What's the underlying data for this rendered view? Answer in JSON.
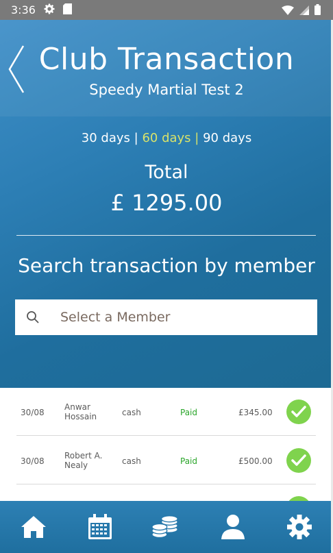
{
  "status_bar": {
    "time": "3:36"
  },
  "header": {
    "title": "Club Transaction",
    "subtitle": "Speedy Martial Test 2"
  },
  "periods": {
    "p30": "30 days",
    "sep1": " | ",
    "p60": "60 days",
    "sep2": " | ",
    "p90": "90 days",
    "active": "60 days"
  },
  "total": {
    "label": "Total",
    "value": "£ 1295.00"
  },
  "search": {
    "heading": "Search transaction by member",
    "placeholder": "Select a Member"
  },
  "transactions": [
    {
      "date": "30/08",
      "member": "Anwar Hossain",
      "method": "cash",
      "status": "Paid",
      "amount": "£345.00"
    },
    {
      "date": "30/08",
      "member": "Robert A. Nealy",
      "method": "cash",
      "status": "Paid",
      "amount": "£500.00"
    }
  ],
  "tabs": [
    "home-icon",
    "calendar-icon",
    "coins-icon",
    "user-icon",
    "gear-icon"
  ],
  "colors": {
    "accent_period": "#d8e36a",
    "paid": "#2aa52a",
    "check": "#7fd34d",
    "primary": "#2c7eb4"
  }
}
